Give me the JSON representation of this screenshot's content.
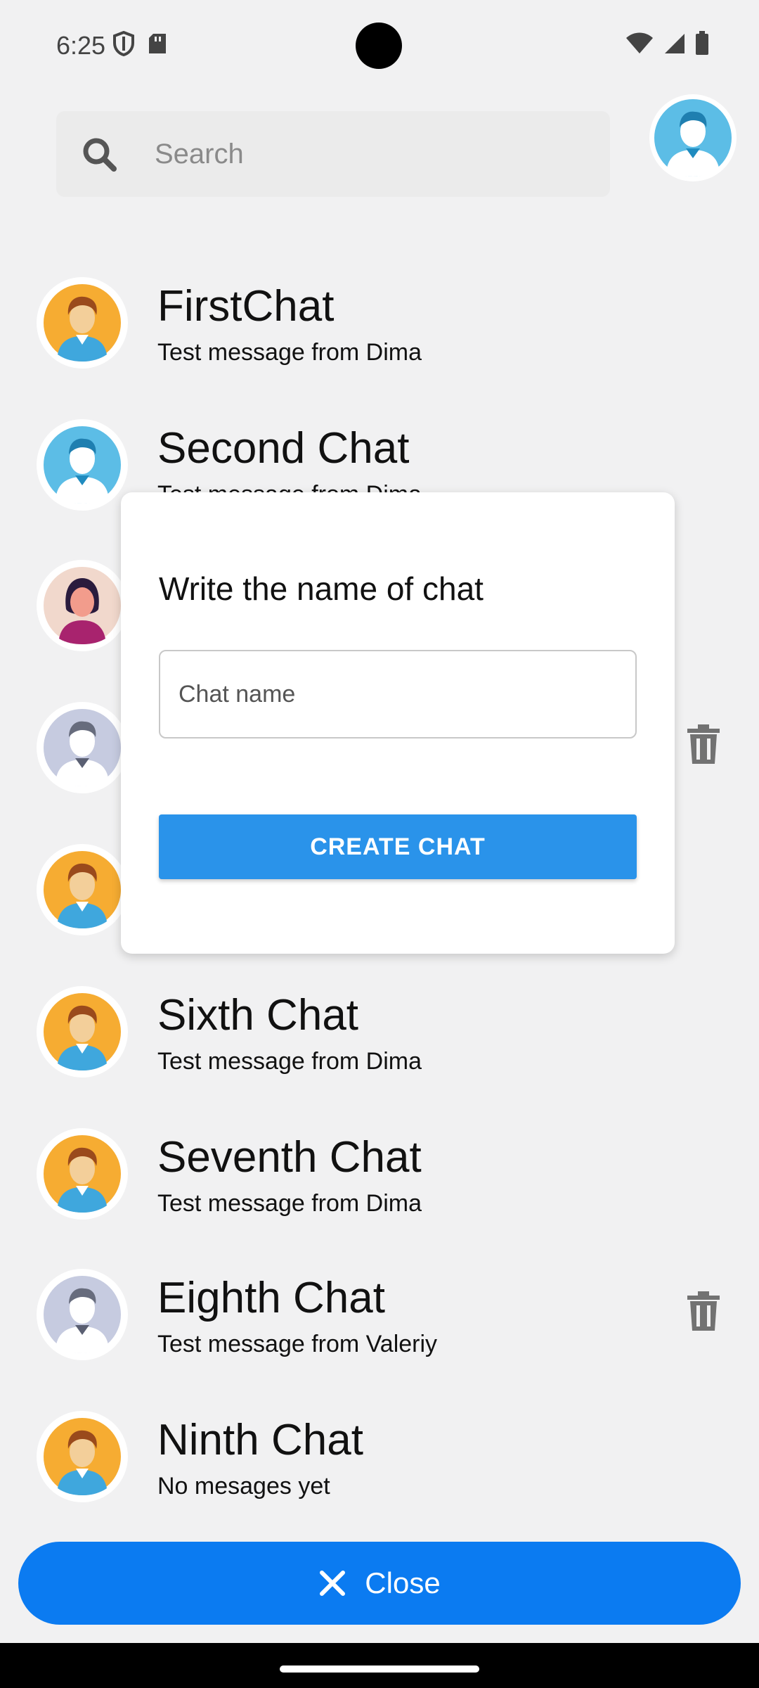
{
  "status_bar": {
    "time": "6:25",
    "left_icons": [
      "shield-icon",
      "sd-card-icon"
    ],
    "right_icons": [
      "wifi-icon",
      "signal-icon",
      "battery-icon"
    ]
  },
  "search": {
    "placeholder": "Search"
  },
  "chats": [
    {
      "title": "FirstChat",
      "message": "Test message from Dima",
      "avatar": "male-orange-avatar",
      "deletable": false
    },
    {
      "title": "Second Chat",
      "message": "Test message from Dima",
      "avatar": "male-blue-avatar",
      "deletable": false
    },
    {
      "title": "",
      "message": "",
      "avatar": "female-pink-avatar",
      "deletable": false
    },
    {
      "title": "",
      "message": "",
      "avatar": "male-grey-avatar",
      "deletable": true
    },
    {
      "title": "",
      "message": "",
      "avatar": "male-orange-avatar",
      "deletable": false
    },
    {
      "title": "Sixth Chat",
      "message": "Test message from Dima",
      "avatar": "male-orange-avatar",
      "deletable": false
    },
    {
      "title": "Seventh Chat",
      "message": "Test message from Dima",
      "avatar": "male-orange-avatar",
      "deletable": false
    },
    {
      "title": "Eighth Chat",
      "message": "Test message from Valeriy",
      "avatar": "male-grey-avatar",
      "deletable": true
    },
    {
      "title": "Ninth Chat",
      "message": "No mesages yet",
      "avatar": "male-orange-avatar",
      "deletable": false
    }
  ],
  "modal": {
    "title": "Write the name of chat",
    "input_placeholder": "Chat name",
    "button_label": "CREATE CHAT"
  },
  "close_button": {
    "label": "Close",
    "icon": "close-icon"
  },
  "colors": {
    "background": "#f1f1f2",
    "primary_blue": "#0b7bf1",
    "dialog_button": "#2a93ea"
  }
}
